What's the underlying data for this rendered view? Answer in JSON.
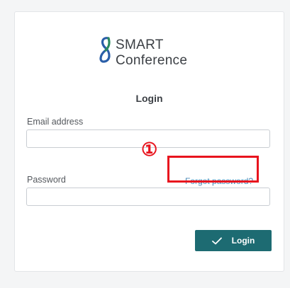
{
  "brand": {
    "line1": "SMART",
    "line2": "Conference"
  },
  "login": {
    "title": "Login",
    "email_label": "Email address",
    "email_value": "",
    "password_label": "Password",
    "password_value": "",
    "forgot_link": "Forgot password?",
    "submit_label": "Login"
  },
  "annotation": {
    "step_marker": "①"
  },
  "colors": {
    "accent": "#1d6b72",
    "link": "#4a86b4",
    "highlight": "#e8141e",
    "logo": "#2a5ea8"
  },
  "icons": {
    "logo": "infinity-s-logo-icon",
    "submit": "checkmark-icon"
  }
}
